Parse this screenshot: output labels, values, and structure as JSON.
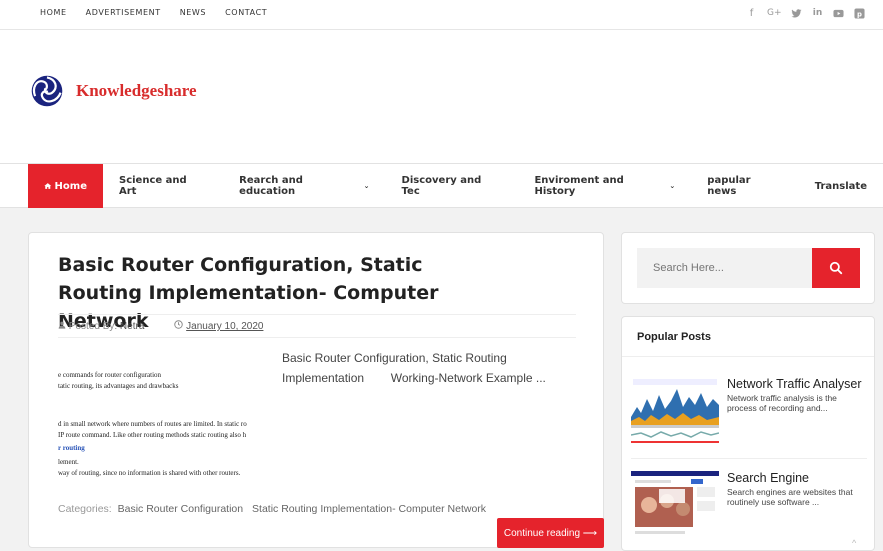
{
  "topnav": [
    "HOME",
    "ADVERTISEMENT",
    "NEWS",
    "CONTACT"
  ],
  "social_icons": [
    "facebook-icon",
    "google-plus-icon",
    "twitter-icon",
    "linkedin-icon",
    "youtube-icon",
    "pinterest-icon"
  ],
  "logo": {
    "text": "Knowledgeshare"
  },
  "mainnav": {
    "home": "Home",
    "items": [
      "Science and Art",
      "Rearch and education",
      "Discovery and Tec",
      "Enviroment and History",
      "papular news",
      "Translate"
    ]
  },
  "post": {
    "title": "Basic Router Configuration, Static Routing Implementation- Computer Network",
    "posted_by_label": "Posted By:",
    "author": "Netra",
    "date": "January 10, 2020",
    "excerpt": "Basic Router Configuration, Static Routing Implementation        Working-Network Example ...",
    "thumb_lines": [
      "e commands for router configuration",
      "tatic routing, its advantages and drawbacks",
      "d in small network where numbers of routes are limited. In static ro",
      " IP route command. Like other routing methods static routing also h",
      "r routing",
      "lement.",
      " way of routing, since no information is shared with other routers."
    ],
    "categories_label": "Categories:",
    "categories": [
      "Basic Router Configuration",
      "Static Routing Implementation- Computer Network"
    ],
    "continue_label": "Continue reading ⟶"
  },
  "search": {
    "placeholder": "Search Here..."
  },
  "popular": {
    "heading": "Popular Posts",
    "items": [
      {
        "title": "Network Traffic Analyser",
        "desc": "Network traffic analysis is the process of recording and..."
      },
      {
        "title": "Search Engine",
        "desc": "Search engines are websites that routinely use software ..."
      }
    ]
  },
  "colors": {
    "accent": "#e5232c",
    "logo_text": "#d82c2c"
  }
}
